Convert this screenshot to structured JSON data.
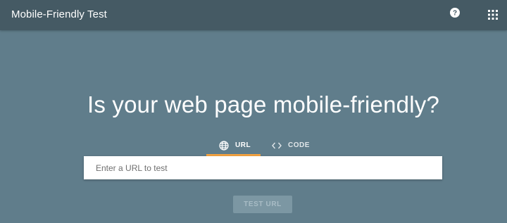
{
  "topbar": {
    "title": "Mobile-Friendly Test",
    "help_icon": "help-circle-icon",
    "apps_icon": "apps-grid-icon"
  },
  "main": {
    "headline": "Is your web page mobile-friendly?",
    "tabs": [
      {
        "label": "URL",
        "icon": "globe-icon",
        "selected": true
      },
      {
        "label": "CODE",
        "icon": "code-icon",
        "selected": false
      }
    ],
    "url_input": {
      "value": "",
      "placeholder": "Enter a URL to test"
    },
    "test_button_label": "TEST URL"
  },
  "colors": {
    "background": "#607d8b",
    "topbar": "#455a64",
    "tab_indicator": "#f4a340"
  }
}
